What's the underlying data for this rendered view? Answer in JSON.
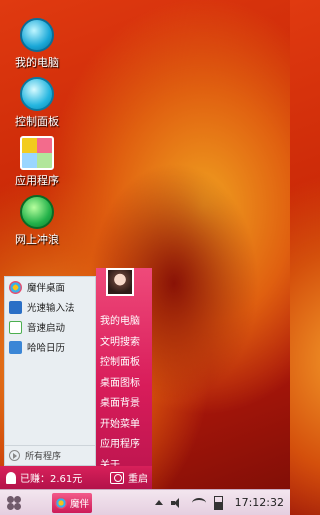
{
  "desktop": {
    "icons": [
      {
        "label": "我的电脑",
        "icon": "computer-icon"
      },
      {
        "label": "控制面板",
        "icon": "control-panel-icon"
      },
      {
        "label": "应用程序",
        "icon": "apps-icon"
      },
      {
        "label": "网上冲浪",
        "icon": "browser-icon"
      }
    ]
  },
  "start_menu": {
    "left_items": [
      {
        "label": "魔伴桌面",
        "icon": "mobao-desktop-icon"
      },
      {
        "label": "光速输入法",
        "icon": "input-method-icon"
      },
      {
        "label": "音速启动",
        "icon": "quick-launch-icon"
      },
      {
        "label": "哈哈日历",
        "icon": "calendar-icon"
      }
    ],
    "all_programs": "所有程序",
    "right_items": [
      "我的电脑",
      "文明搜索",
      "控制面板",
      "桌面图标",
      "桌面背景",
      "开始菜单",
      "应用程序",
      "关于.."
    ],
    "earned": "已赚：2.61元",
    "restart": "重启"
  },
  "taskbar": {
    "task_label": "魔伴",
    "clock": "17:12:32"
  },
  "colors": {
    "accent": "#d81c5a",
    "taskbar": "#f0e0ec"
  }
}
